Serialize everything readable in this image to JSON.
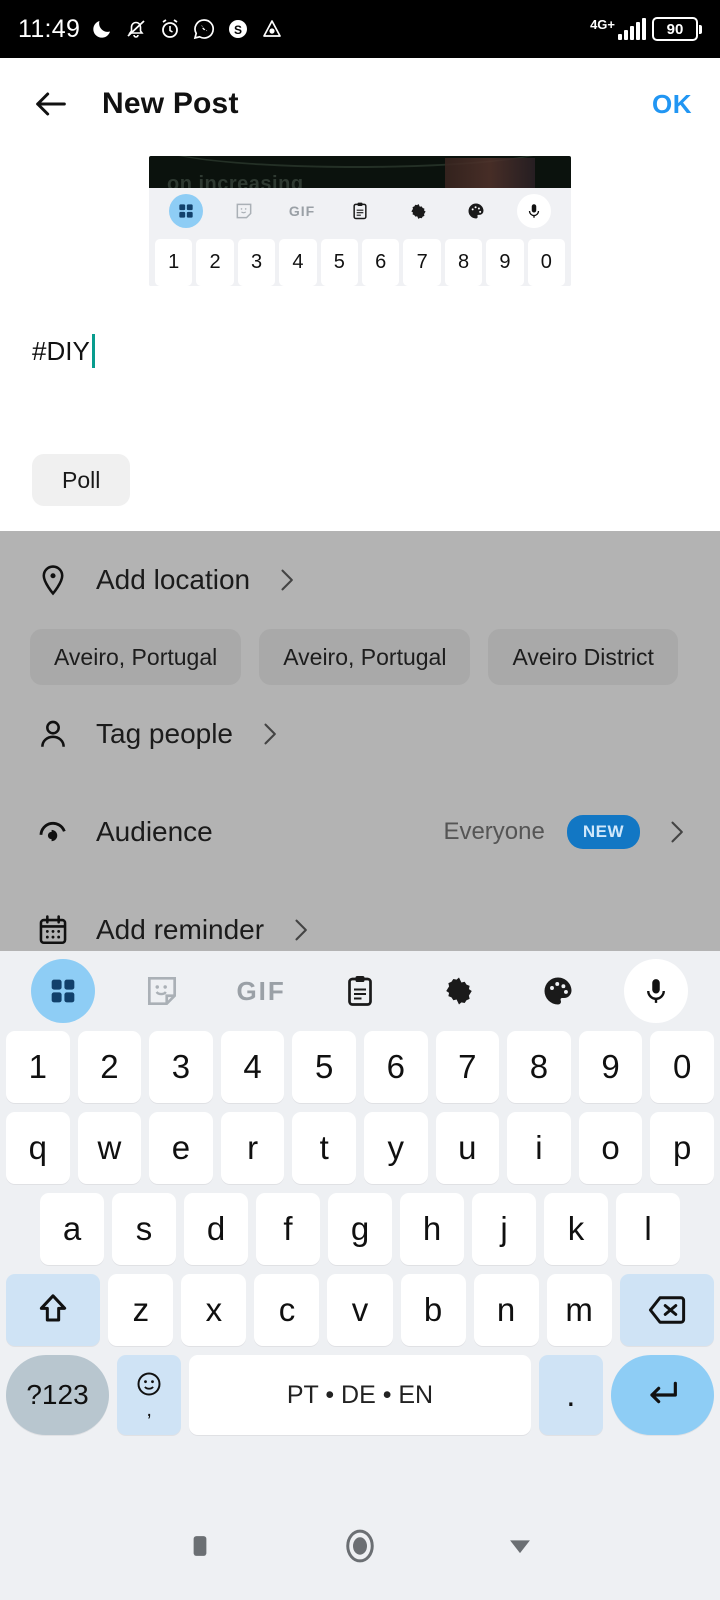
{
  "status_bar": {
    "time": "11:49",
    "icons": [
      "moon-icon",
      "bell-muted-icon",
      "alarm-clock-icon",
      "whatsapp-icon",
      "skype-icon",
      "triangle-app-icon"
    ],
    "network_type": "4G+",
    "battery_level": "90"
  },
  "header": {
    "back_label": "back",
    "title": "New Post",
    "confirm_label": "OK"
  },
  "media": {
    "ghost_text": "on increasing",
    "mini_toolbar": [
      "grid-icon",
      "sticker-icon",
      "GIF",
      "clipboard-icon",
      "gear-icon",
      "palette-icon",
      "mic-icon"
    ],
    "mini_numbers": [
      "1",
      "2",
      "3",
      "4",
      "5",
      "6",
      "7",
      "8",
      "9",
      "0"
    ]
  },
  "composer": {
    "text": "#DIY",
    "poll_label": "Poll"
  },
  "options": {
    "location": {
      "label": "Add location",
      "icon": "location-pin-icon",
      "suggestions": [
        "Aveiro, Portugal",
        "Aveiro, Portugal",
        "Aveiro District"
      ]
    },
    "tag_people": {
      "label": "Tag people",
      "icon": "person-icon"
    },
    "audience": {
      "label": "Audience",
      "icon": "audience-icon",
      "value": "Everyone",
      "badge": "NEW"
    },
    "reminder": {
      "label": "Add reminder",
      "icon": "calendar-icon"
    }
  },
  "keyboard": {
    "toolbar": [
      "grid-icon",
      "sticker-icon",
      "GIF",
      "clipboard-icon",
      "gear-icon",
      "palette-icon",
      "mic-icon"
    ],
    "gif_label": "GIF",
    "rows": {
      "numbers": [
        "1",
        "2",
        "3",
        "4",
        "5",
        "6",
        "7",
        "8",
        "9",
        "0"
      ],
      "top": [
        "q",
        "w",
        "e",
        "r",
        "t",
        "y",
        "u",
        "i",
        "o",
        "p"
      ],
      "home": [
        "a",
        "s",
        "d",
        "f",
        "g",
        "h",
        "j",
        "k",
        "l"
      ],
      "bottom": [
        "z",
        "x",
        "c",
        "v",
        "b",
        "n",
        "m"
      ]
    },
    "shift_label": "shift",
    "backspace_label": "backspace",
    "symbols_label": "?123",
    "emoji_label": "☺",
    "comma_label": ",",
    "space_label": "PT • DE • EN",
    "period_label": ".",
    "enter_label": "enter"
  },
  "navbar": {
    "recents_label": "recents",
    "home_label": "home",
    "back_label": "dismiss-keyboard"
  },
  "colors": {
    "accent_blue": "#2196f3",
    "key_accent": "#8ecdf5",
    "badge_blue": "#1277c4",
    "overlay_gray": "#b3b3b3",
    "caret_teal": "#089c8e"
  }
}
